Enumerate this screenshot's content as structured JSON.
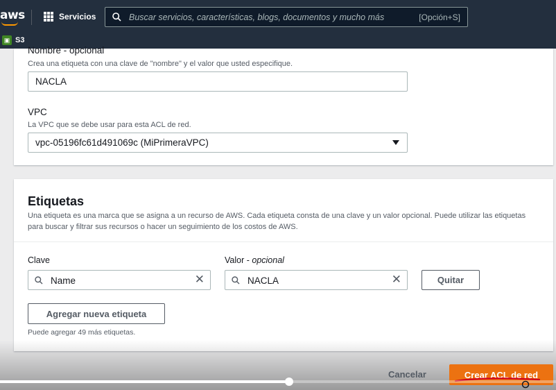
{
  "topnav": {
    "logo": "aws",
    "services_label": "Servicios",
    "search_placeholder": "Buscar servicios, características, blogs, documentos y mucho más",
    "search_shortcut": "[Opción+S]",
    "icons": [
      "grid-icon",
      "search-icon"
    ]
  },
  "subnav": {
    "service_label": "S3",
    "service_icon": "s3-icon"
  },
  "form": {
    "name_label": "Nombre - opcional",
    "name_desc": "Crea una etiqueta con una clave de \"nombre\" y el valor que usted especifique.",
    "name_value": "NACLA",
    "vpc_label": "VPC",
    "vpc_desc": "La VPC que se debe usar para esta ACL de red.",
    "vpc_value": "vpc-05196fc61d491069c (MiPrimeraVPC)"
  },
  "tags": {
    "title": "Etiquetas",
    "description": "Una etiqueta es una marca que se asigna a un recurso de AWS. Cada etiqueta consta de una clave y un valor opcional. Puede utilizar las etiquetas para buscar y filtrar sus recursos o hacer un seguimiento de los costos de AWS.",
    "key_label": "Clave",
    "value_label": "Valor",
    "value_label_suffix": "opcional",
    "key_value": "Name",
    "value_value": "NACLA",
    "remove_button": "Quitar",
    "add_button": "Agregar nueva etiqueta",
    "limit_note": "Puede agregar 49 más etiquetas."
  },
  "actions": {
    "cancel": "Cancelar",
    "create": "Crear ACL de red"
  },
  "video": {
    "progress": 0.52
  },
  "colors": {
    "nav_bg": "#232f3e",
    "primary": "#ec7211",
    "annotation": "#d0021b"
  }
}
